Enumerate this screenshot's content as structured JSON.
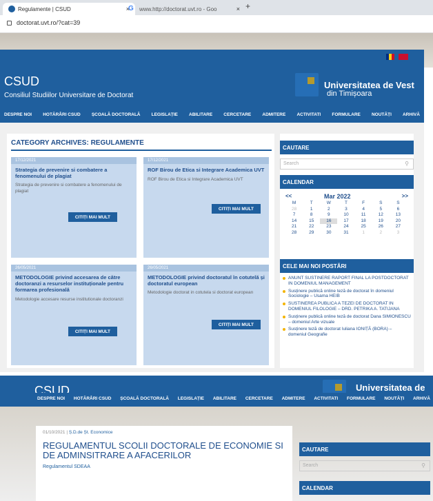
{
  "browser": {
    "active_tab_title": "Regulamente | CSUD",
    "other_tab_title": "www.http://doctorat.uvt.ro - Goo",
    "tab_close": "×",
    "new_tab": "+",
    "url": "doctorat.uvt.ro/?cat=39"
  },
  "site": {
    "name": "CSUD",
    "subtitle": "Consiliul Studiilor Universitare de Doctorat",
    "uni_name_line1": "Universitatea de Vest",
    "uni_name_line2": "din Timișoara"
  },
  "nav": [
    "DESPRE NOI",
    "HOTĂRÂRI CSUD",
    "ȘCOALĂ DOCTORALĂ",
    "LEGISLAȚIE",
    "ABILITARE",
    "CERCETARE",
    "ADMITERE",
    "ACTIVITATI",
    "FORMULARE",
    "NOUTĂȚI",
    "ARHIVĂ"
  ],
  "category_title": "CATEGORY ARCHIVES: REGULAMENTE",
  "read_more": "CITIȚI MAI MULT",
  "posts": [
    {
      "date": "17/12/2021",
      "title": "Strategia de prevenire si combatere a fenomenului de plagiat",
      "excerpt": "Strategia de prevenire si combatere a fenomenului de plagiat"
    },
    {
      "date": "17/12/2021",
      "title": "ROF Birou de Etica si Integrare Academica UVT",
      "excerpt": "ROF Birou de Etica si Integrare Academica UVT"
    },
    {
      "date": "26/05/2021",
      "title": "METODOLOGIE privind accesarea de către doctoranzi a resurselor instituționale pentru formarea profesională",
      "excerpt": "Metodologie accesare resurse institutionale doctoranzi"
    },
    {
      "date": "26/05/2021",
      "title": "METODOLOGIE privind doctoratul în cotutelă și doctoratul european",
      "excerpt": "Metodologie doctorat in cotutela si doctorat european"
    }
  ],
  "sidebar": {
    "search_title": "CAUTARE",
    "search_placeholder": "Search",
    "calendar_title": "CALENDAR",
    "cal_prev": "<<",
    "cal_next": ">>",
    "cal_month": "Mar 2022",
    "cal_days": [
      "M",
      "T",
      "W",
      "T",
      "F",
      "S",
      "S"
    ],
    "cal_cells": [
      {
        "d": "28",
        "m": true
      },
      {
        "d": "1"
      },
      {
        "d": "2"
      },
      {
        "d": "3"
      },
      {
        "d": "4"
      },
      {
        "d": "5"
      },
      {
        "d": "6"
      },
      {
        "d": "7"
      },
      {
        "d": "8"
      },
      {
        "d": "9"
      },
      {
        "d": "10"
      },
      {
        "d": "11"
      },
      {
        "d": "12"
      },
      {
        "d": "13"
      },
      {
        "d": "14"
      },
      {
        "d": "15"
      },
      {
        "d": "16",
        "t": true
      },
      {
        "d": "17"
      },
      {
        "d": "18"
      },
      {
        "d": "19"
      },
      {
        "d": "20"
      },
      {
        "d": "21"
      },
      {
        "d": "22"
      },
      {
        "d": "23"
      },
      {
        "d": "24"
      },
      {
        "d": "25"
      },
      {
        "d": "26"
      },
      {
        "d": "27"
      },
      {
        "d": "28"
      },
      {
        "d": "29"
      },
      {
        "d": "30"
      },
      {
        "d": "31"
      },
      {
        "d": "1",
        "m": true
      },
      {
        "d": "2",
        "m": true
      },
      {
        "d": "3",
        "m": true
      }
    ],
    "recent_title": "CELE MAI NOI POSTĂRI",
    "recent": [
      "ANUNT SUSTINERE RAPORT FINAL LA POSTDOCTORAT IN DOMENIUL MANAGEMENT",
      "Susținere publică online teză de doctorat în domeniul Sociologie – Usama HEIB",
      "SUSTINEREA PUBLICA A TEZEI DE DOCTORAT IN DOMENIUL FILOLOGIE – DRD. PETRIKA A. TATIJANA",
      "Susținere publică online teză de doctorat Dana SIMIONESCU – domeniul Arte vizuale",
      "Susținere teză de doctorat Iuliana IONIȚĂ (BORA) – domeniul Geografie"
    ]
  },
  "second_page": {
    "date": "01/10/2021",
    "separator": "|",
    "category": "Ș.D.de Șt. Economice",
    "title": "REGULAMENTUL SCOLII DOCTORALE DE ECONOMIE SI DE ADMINSITRARE A AFACERILOR",
    "subtitle": "Regulamentul SDEAA"
  },
  "colors": {
    "brand_blue": "#1f5f9e",
    "card_blue": "#c7d9ee",
    "accent_yellow": "#f4b400"
  }
}
